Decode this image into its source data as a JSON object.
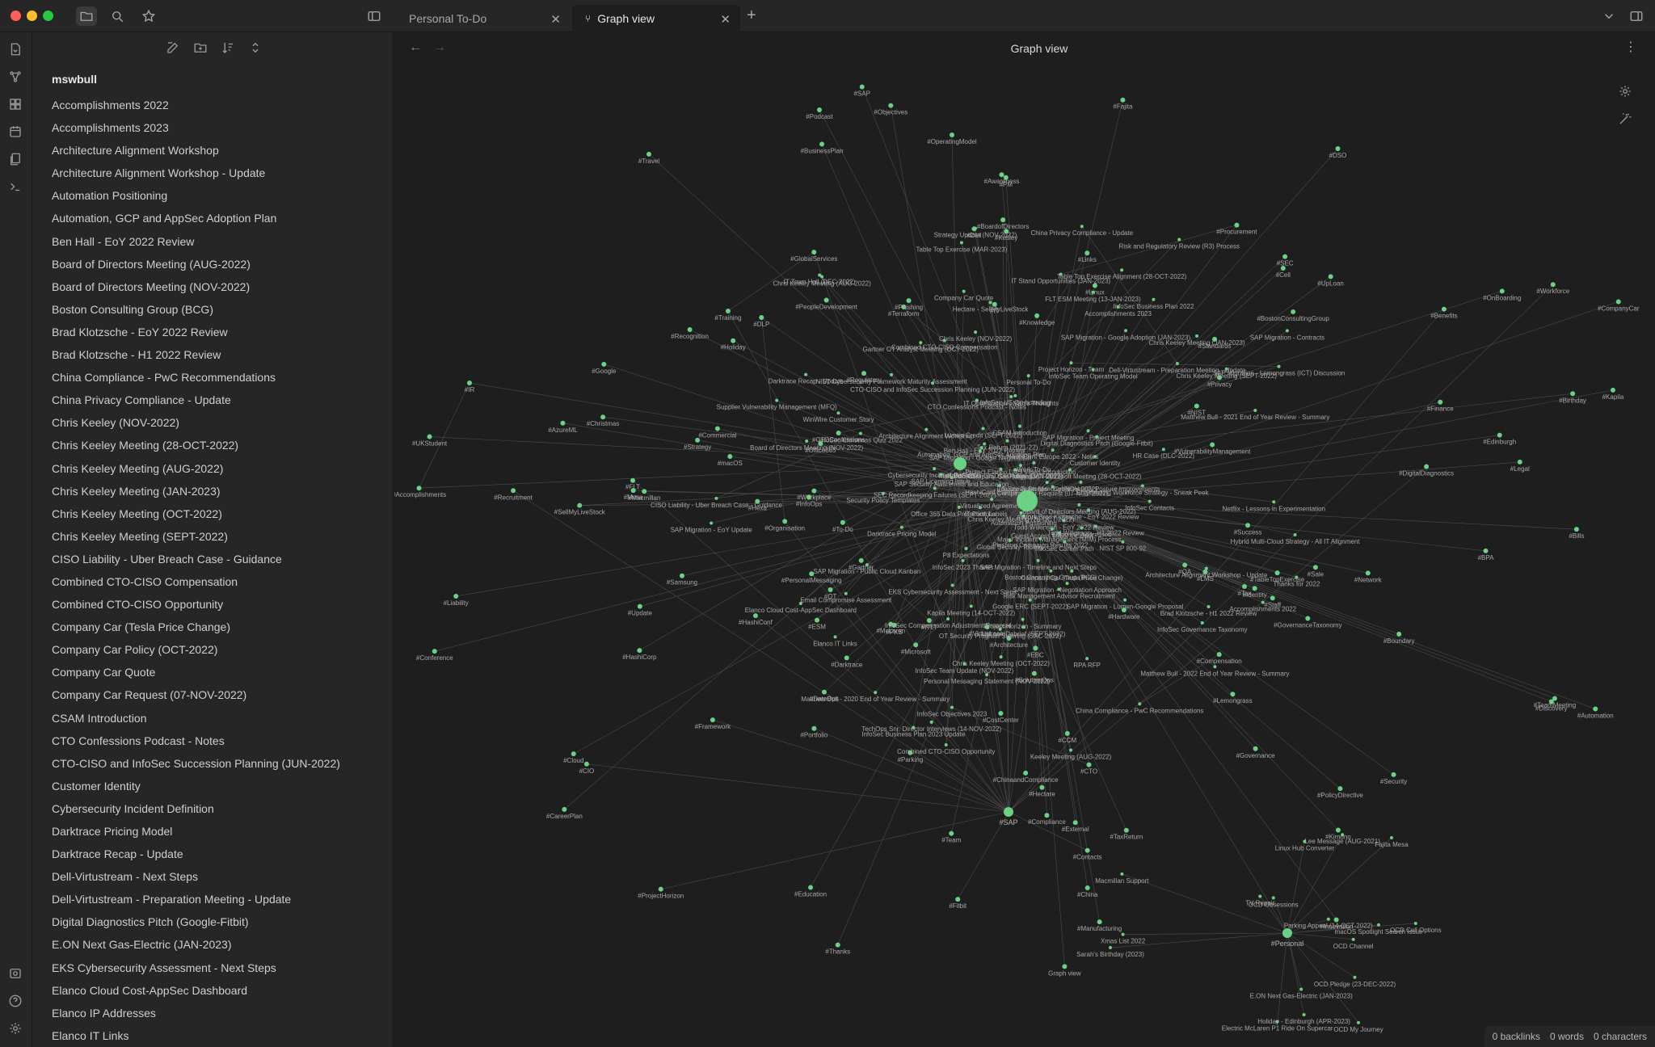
{
  "tabs": [
    {
      "label": "Personal To-Do",
      "active": false
    },
    {
      "label": "Graph view",
      "active": true
    }
  ],
  "explorer": {
    "vault": "mswbull",
    "files": [
      "Accomplishments 2022",
      "Accomplishments 2023",
      "Architecture Alignment Workshop",
      "Architecture Alignment Workshop - Update",
      "Automation Positioning",
      "Automation, GCP and AppSec Adoption Plan",
      "Ben Hall - EoY 2022 Review",
      "Board of Directors Meeting (AUG-2022)",
      "Board of Directors Meeting (NOV-2022)",
      "Boston Consulting Group (BCG)",
      "Brad Klotzsche - EoY 2022 Review",
      "Brad Klotzsche - H1 2022 Review",
      "China Compliance - PwC Recommendations",
      "China Privacy Compliance - Update",
      "Chris Keeley (NOV-2022)",
      "Chris Keeley Meeting (28-OCT-2022)",
      "Chris Keeley Meeting (AUG-2022)",
      "Chris Keeley Meeting (JAN-2023)",
      "Chris Keeley Meeting (OCT-2022)",
      "Chris Keeley Meeting (SEPT-2022)",
      "CISO Liability - Uber Breach Case - Guidance",
      "Combined CTO-CISO Compensation",
      "Combined CTO-CISO Opportunity",
      "Company Car (Tesla Price Change)",
      "Company Car Policy (OCT-2022)",
      "Company Car Quote",
      "Company Car Request (07-NOV-2022)",
      "CSAM Introduction",
      "CTO Confessions Podcast - Notes",
      "CTO-CISO and InfoSec Succession Planning (JUN-2022)",
      "Customer Identity",
      "Cybersecurity Incident Definition",
      "Darktrace Pricing Model",
      "Darktrace Recap - Update",
      "Dell-Virtustream - Next Steps",
      "Dell-Virtustream - Preparation Meeting - Update",
      "Digital Diagnostics Pitch (Google-Fitbit)",
      "E.ON Next Gas-Electric (JAN-2023)",
      "EKS Cybersecurity Assessment - Next Steps",
      "Elanco Cloud Cost-AppSec Dashboard",
      "Elanco IP Addresses",
      "Elanco IT Links"
    ]
  },
  "main": {
    "title": "Graph view",
    "back_arrow": "←",
    "forward_arrow": "→",
    "more": "⋮"
  },
  "graph": {
    "hubs": [
      {
        "label": "#Work"
      },
      {
        "label": "#InfoSec"
      },
      {
        "label": "#SAP"
      },
      {
        "label": "#Personal"
      }
    ],
    "labels": [
      "#SellMyLiveStock",
      "#Hectare",
      "#Discovery",
      "#HashiConf",
      "#Boundary",
      "#Terraform",
      "#Hexa",
      "#CompanyCar",
      "#Conference",
      "#HashiCorp",
      "#Innovation",
      "#External",
      "#Kimono",
      "#PKS",
      "#UpLoan",
      "#Training",
      "#Compensation",
      "#LMS",
      "#BusinessPlan",
      "#Update",
      "#Procurement",
      "#CostCenter",
      "#Fitbit",
      "#Workforce",
      "#CTOConfessions",
      "#Darktrace",
      "#Podcast",
      "#VulnerabilityManagement",
      "#Recognition",
      "#DigitalDiagnostics",
      "#Organisation",
      "#Architecture",
      "#Objectives",
      "#Manufacturing",
      "#Success",
      "#IR",
      "#Workplace",
      "#InfoOps",
      "#CCM",
      "#Hardware",
      "#OT",
      "#Gartner",
      "#BoardofDirectors",
      "#PeopleDevelopment",
      "#TeamMeeting",
      "#TableTopExercise",
      "#BPA",
      "#Framework",
      "#PersonalMessaging",
      "#Accomplishments",
      "#Kapila",
      "#Recruitment",
      "#Travel",
      "#Automation",
      "#GlobalServices",
      "#FLT",
      "#Network",
      "#Legal",
      "#Phishing",
      "#Strategy",
      "#Finance",
      "#ESM",
      "#Kesley",
      "#Cloud",
      "#Portfolio",
      "#Identity",
      "#ChinaandCompliance",
      "#ITLT",
      "#PM",
      "#Privacy",
      "#CTO",
      "#Security",
      "#Commercial",
      "#China",
      "#Contacts",
      "#CareerPlan",
      "#Staff",
      "#OperatingModel",
      "#DataOps",
      "#Benefits",
      "#Team",
      "#DLP",
      "#Google",
      "#CIO",
      "#AzureML",
      "#Tax",
      "#OnBoarding",
      "#SEC",
      "#BostonConsultingGroup",
      "#EBC",
      "#ProjectHorizon",
      "#Office365",
      "#Governance",
      "#Compliance",
      "#TaxReturn",
      "#QA",
      "#To-Do",
      "#GovernanceTaxonomy",
      "#Standards",
      "#DSO",
      "#NIST",
      "#Regulatory",
      "#Thanks",
      "#PolicyDirective",
      "#SolutionOps",
      "#Sale",
      "#Christmas",
      "#McLaren",
      "#Lemongrass",
      "#Microsoft",
      "#Education",
      "#UKStudent",
      "#Awareness",
      "#Links",
      "#Liability",
      "#Macmillan",
      "#Fajita",
      "#IT",
      "#Knowledge",
      "#Virtustream",
      "#Dell",
      "#Mesa",
      "#Bills",
      "#SAP",
      "#Birthday",
      "#Parking",
      "#Cell",
      "#Linux",
      "#Holiday",
      "#Samsung",
      "#macOS",
      "#Edinburgh",
      "Graph view"
    ],
    "notes": [
      "Hectare - SellMyLiveStock",
      "HashiConf Europe 2022 - Notes",
      "Netflix - Lessons in Experimentation",
      "Company Car Policy (OCT-2022)",
      "Company Car (Tesla Price Change)",
      "Company Car Request (07-NOV-2022)",
      "WinWire Customer Story",
      "UpLook Debrief (SEPT-2022)",
      "HashiConf Europe 2023",
      "Company Car Quote",
      "TechOps Snr. Director Interviews (14-NOV-2022)",
      "Protect Elanco LMS Video Introduction",
      "InfoSec Compensation Adjustment Proposal",
      "Darktrace Recap - Update",
      "Digital Diagnostics Pitch (Google-Fitbit)",
      "CTO Confessions Podcast - Notes",
      "EKS Cybersecurity Assessment - Next Steps",
      "InfoSec Business Plan 2023 Update",
      "Engineering Workforce Strategy - Sneak Peek",
      "Risk and Regulatory Review (R3) Process",
      "Risk Management Advisor Recruitment",
      "Supplier Vulnerability Management (MFQ)",
      "InfoSec Objectives 2023",
      "InfoSec Business Plan 2022",
      "Matt Bull (CTO-CISO) - Update (JAN-2022)",
      "Success Stories - Cybersecurity Posture Improvements",
      "Darktrace Pricing Model",
      "P8 Expectations",
      "Major Incident Management (MIM) Process",
      "OT Security Program Steering (SXC-2022)",
      "Brad Klotzsche - H1 2022 Review",
      "Brad Klotzsche - EoY 2022 Review",
      "Architecture Alignment Workshop",
      "Architecture Alignment Workshop - Update",
      "HR Case (DLC-2022)",
      "Ben Hall - EoY 2022 Review",
      "Cybersecurity Incident Definition",
      "Board of Directors Meeting (AUG-2022)",
      "Lumen Credit (SEPT-2022)",
      "Table Top Exercise (MAR-2023)",
      "Gartner OT Analyst Meeting (OCT-2022)",
      "Chris Keeley Meeting (SEPT-2022)",
      "Chris Keeley Meeting (JAN-2023)",
      "InfoSec Team Meeting (NOV-2022)",
      "IT Town Hall (DEC-2022)",
      "Automation Positioning",
      "Personal Messaging Statement (NOV-2022)",
      "Todd Wilkinson - H1 2022 Review",
      "Todd Wilkinson - EoY 2022 Review",
      "Table Top Exercise Alignment (28-OCT-2022)",
      "Board of Directors Meeting (NOV-2022)",
      "CSAM Introduction",
      "Accomplishments 2023",
      "RPA RFP",
      "Kapila Meeting (14-OCT-2022)",
      "InfoSec Christmas Quiz 2022",
      "InfoSec 2023 Thanks",
      "Elanco IP Addresses",
      "Chris Keeley Meeting (OCT-2022)",
      "Keeley Meeting (AUG-2022)",
      "Email Compromise Assessment",
      "Phishing Campaign Results 2022",
      "Accomplishments 2022",
      "IT Portfolio",
      "CTO-CISO and InfoSec Succession Planning (JUN-2022)",
      "InfoSec Career Path",
      "Elanco Cloud Cost-AppSec Dashboard",
      "FLT ESM Meeting (13-JAN-2023)",
      "InfoSec US On-boarding",
      "Chris Keeley Meeting (AUG-2022)",
      "Customer Identity",
      "InfoSec Contacts",
      "Matthew Bull - 2020 End of Year Review - Summary",
      "Global Security Tooling",
      "InfoSec Team Update (NOV-2022)",
      "IT Stand Opportunities (JAN-2023)",
      "Matthew Bull - 2022 End of Year Review - Summary",
      "Project Horizon - Team",
      "China Compliance - PwC Recommendations",
      "Chris Keeley (NOV-2022)",
      "China Privacy Compliance - Update",
      "InfoSec Team Operating Model",
      "Project Horizon - Summary",
      "Security Policy Templates",
      "Matthew Bull - 2021 End of Year Review - Summary",
      "Hybrid Multi-Cloud Strategy - All IT Alignment",
      "Guest Access Major Incident",
      "Work To-Do",
      "Combined CTO-CISO Opportunity",
      "NIST SP 800-92",
      "NIST Cybersecurity Framework Maturity Assessment",
      "Chris Keeley Meeting (28-OCT-2022)",
      "SEC Recordkeeping Failures (SEPT-2022)",
      "Combined CTO-CISO Compensation",
      "Google ERC (SEPT-2022)",
      "Automation, GCP and AppSec Adoption Plan",
      "Boston Consulting Group (BCG)",
      "Office 365 Data Protection Labels",
      "IT Optimization - Matt's Thoughts",
      "SAP Migration - EoY Update",
      "InfoSec Governance Taxonomy",
      "Thanks for 2022",
      "Strategy Update (NOV-2022)",
      "SAP Licensing Issue",
      "SAP Migration - Project Meeting",
      "SAP Migration - Negotiation Approach",
      "SAP Migration - Contracts",
      "SAP Migration - Public Cloud Kanban",
      "SAP Migration - Lumen-Google Proposal",
      "SAP Security Awareness and Education",
      "SAP Migration - Microsoft Meeting (28-OCT-2022)",
      "SAP Migration - Google Adoption (JAN-2023)",
      "SAP Migration - Google Negotiation",
      "Tax Return (2021-22)",
      "CISO Liability - Uber Breach Case - Guidance",
      "Virtualized Agreement",
      "SAP Migration - Lemongrass (ICT) Discussion",
      "Elanco IT Links",
      "SAP Migration - Timeline and Next Steps",
      "Dell-Virtustream - Preparation Meeting - Update",
      "Personal To-Do",
      "Electric McLaren P1 Ride On Supercar",
      "Xmas List 2022",
      "Macmillan Support",
      "Fajita Mesa",
      "Lee Message (AUG-2021)",
      "E.ON Next Gas-Electric (JAN-2023)",
      "Parking Appeal (14-OCT-2022)",
      "Sarah's Birthday (2023)",
      "TV Repair",
      "OCD Cell Options",
      "Linux Hub Converter",
      "OCD My Journey",
      "Holiday - Edinburgh (APR-2023)",
      "OCD Channel",
      "OCD Pledge (23-DEC-2022)",
      "macOS Spotlight Search Issue",
      "OCD Obsessions"
    ]
  },
  "status": {
    "backlinks": "0 backlinks",
    "words": "0 words",
    "characters": "0 characters"
  },
  "colors": {
    "node": "#6bd183",
    "edge": "#4a4a4a",
    "background": "#1e1e1e",
    "panel": "#262626"
  }
}
